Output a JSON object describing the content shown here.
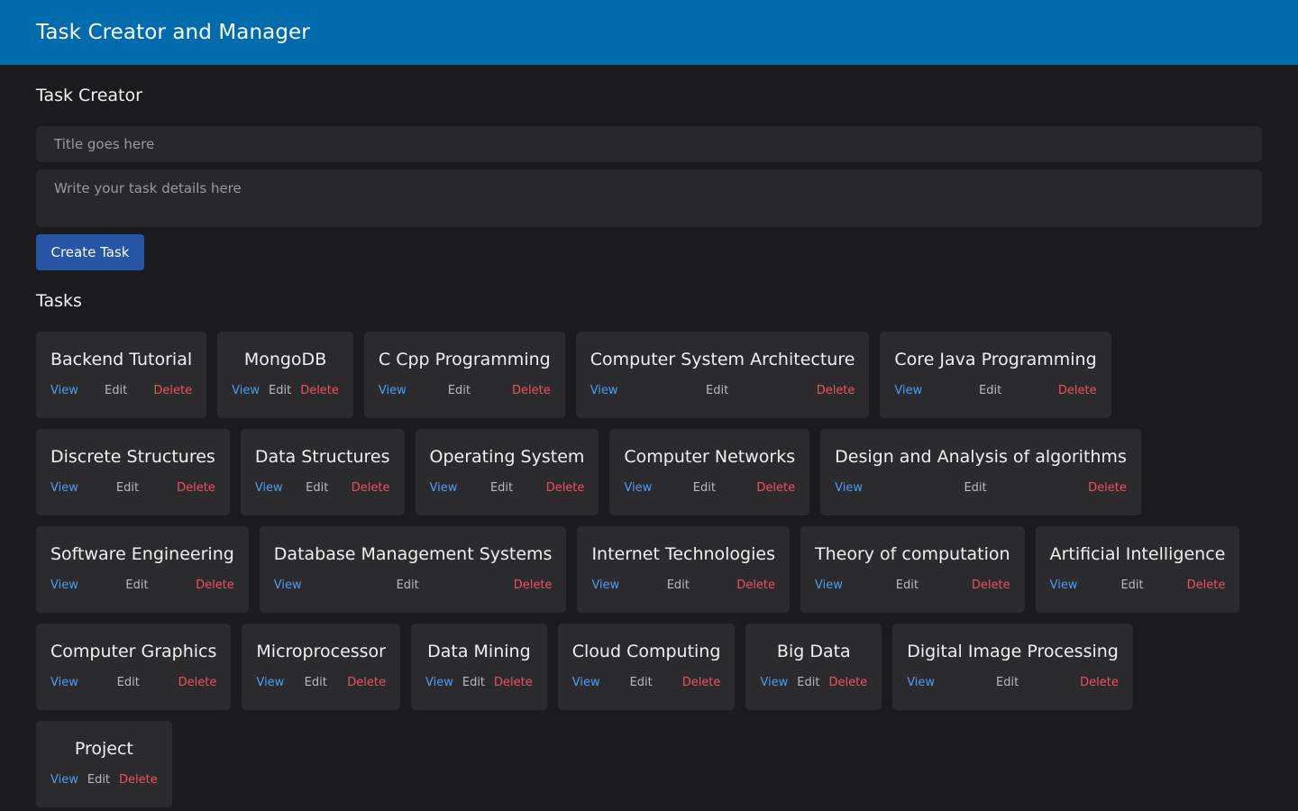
{
  "header": {
    "title": "Task Creator and Manager"
  },
  "creator": {
    "heading": "Task Creator",
    "title_placeholder": "Title goes here",
    "title_value": "",
    "details_placeholder": "Write your task details here",
    "details_value": "",
    "create_label": "Create Task"
  },
  "tasks_section": {
    "heading": "Tasks"
  },
  "actions": {
    "view": "View",
    "edit": "Edit",
    "delete": "Delete"
  },
  "colors": {
    "header_bg": "#006cad",
    "page_bg": "#1b1b1d",
    "card_bg": "#2b2b2e",
    "button_bg": "#2756a7",
    "view": "#4d9cf5",
    "edit": "#b9b9b9",
    "delete": "#f0505f"
  },
  "tasks": [
    {
      "title": "Backend Tutorial"
    },
    {
      "title": "MongoDB"
    },
    {
      "title": "C Cpp Programming"
    },
    {
      "title": "Computer System Architecture"
    },
    {
      "title": "Core Java Programming"
    },
    {
      "title": "Discrete Structures"
    },
    {
      "title": "Data Structures"
    },
    {
      "title": "Operating System"
    },
    {
      "title": "Computer Networks"
    },
    {
      "title": "Design and Analysis of algorithms"
    },
    {
      "title": "Software Engineering"
    },
    {
      "title": "Database Management Systems"
    },
    {
      "title": "Internet Technologies"
    },
    {
      "title": "Theory of computation"
    },
    {
      "title": "Artificial Intelligence"
    },
    {
      "title": "Computer Graphics"
    },
    {
      "title": "Microprocessor"
    },
    {
      "title": "Data Mining"
    },
    {
      "title": "Cloud Computing"
    },
    {
      "title": "Big Data"
    },
    {
      "title": "Digital Image Processing"
    },
    {
      "title": "Project"
    }
  ]
}
